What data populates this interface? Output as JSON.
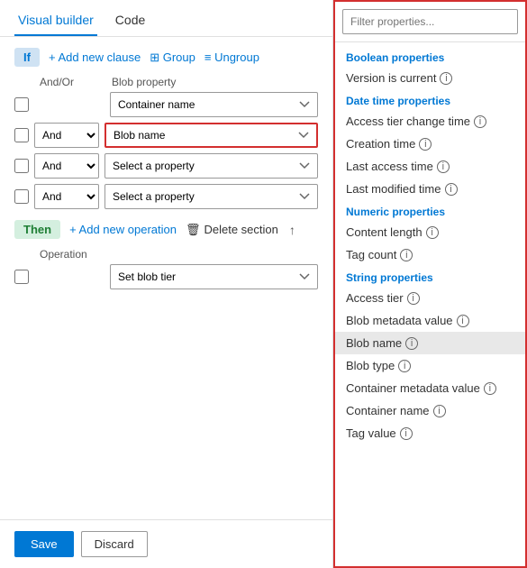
{
  "tabs": [
    {
      "label": "Visual builder",
      "active": true
    },
    {
      "label": "Code",
      "active": false
    }
  ],
  "if_section": {
    "badge": "If",
    "add_clause_label": "+ Add new clause",
    "group_label": "⊞ Group",
    "ungroup_label": "≡ Ungroup",
    "col_andor": "And/Or",
    "col_blob": "Blob property",
    "clauses": [
      {
        "id": 1,
        "hasAndOr": false,
        "andor": "",
        "property": "Container name",
        "highlighted": false
      },
      {
        "id": 2,
        "hasAndOr": true,
        "andor": "And",
        "property": "Blob name",
        "highlighted": true
      },
      {
        "id": 3,
        "hasAndOr": true,
        "andor": "And",
        "property": "Select a property",
        "highlighted": false,
        "placeholder": true
      },
      {
        "id": 4,
        "hasAndOr": true,
        "andor": "And",
        "property": "Select a property",
        "highlighted": false,
        "placeholder": true
      }
    ]
  },
  "then_section": {
    "badge": "Then",
    "add_op_label": "+ Add new operation",
    "delete_label": "Delete section",
    "col_op": "Operation",
    "operation": "Set blob tier"
  },
  "footer": {
    "save_label": "Save",
    "discard_label": "Discard"
  },
  "properties_panel": {
    "filter_placeholder": "Filter properties...",
    "categories": [
      {
        "label": "Boolean properties",
        "items": [
          {
            "label": "Version is current",
            "info": true
          }
        ]
      },
      {
        "label": "Date time properties",
        "items": [
          {
            "label": "Access tier change time",
            "info": true
          },
          {
            "label": "Creation time",
            "info": true
          },
          {
            "label": "Last access time",
            "info": true
          },
          {
            "label": "Last modified time",
            "info": true
          }
        ]
      },
      {
        "label": "Numeric properties",
        "items": [
          {
            "label": "Content length",
            "info": true
          },
          {
            "label": "Tag count",
            "info": true
          }
        ]
      },
      {
        "label": "String properties",
        "items": [
          {
            "label": "Access tier",
            "info": true
          },
          {
            "label": "Blob metadata value",
            "info": true
          },
          {
            "label": "Blob name",
            "info": true,
            "selected": true
          },
          {
            "label": "Blob type",
            "info": true
          },
          {
            "label": "Container metadata value",
            "info": true
          },
          {
            "label": "Container name",
            "info": true
          },
          {
            "label": "Tag value",
            "info": true
          }
        ]
      }
    ]
  }
}
